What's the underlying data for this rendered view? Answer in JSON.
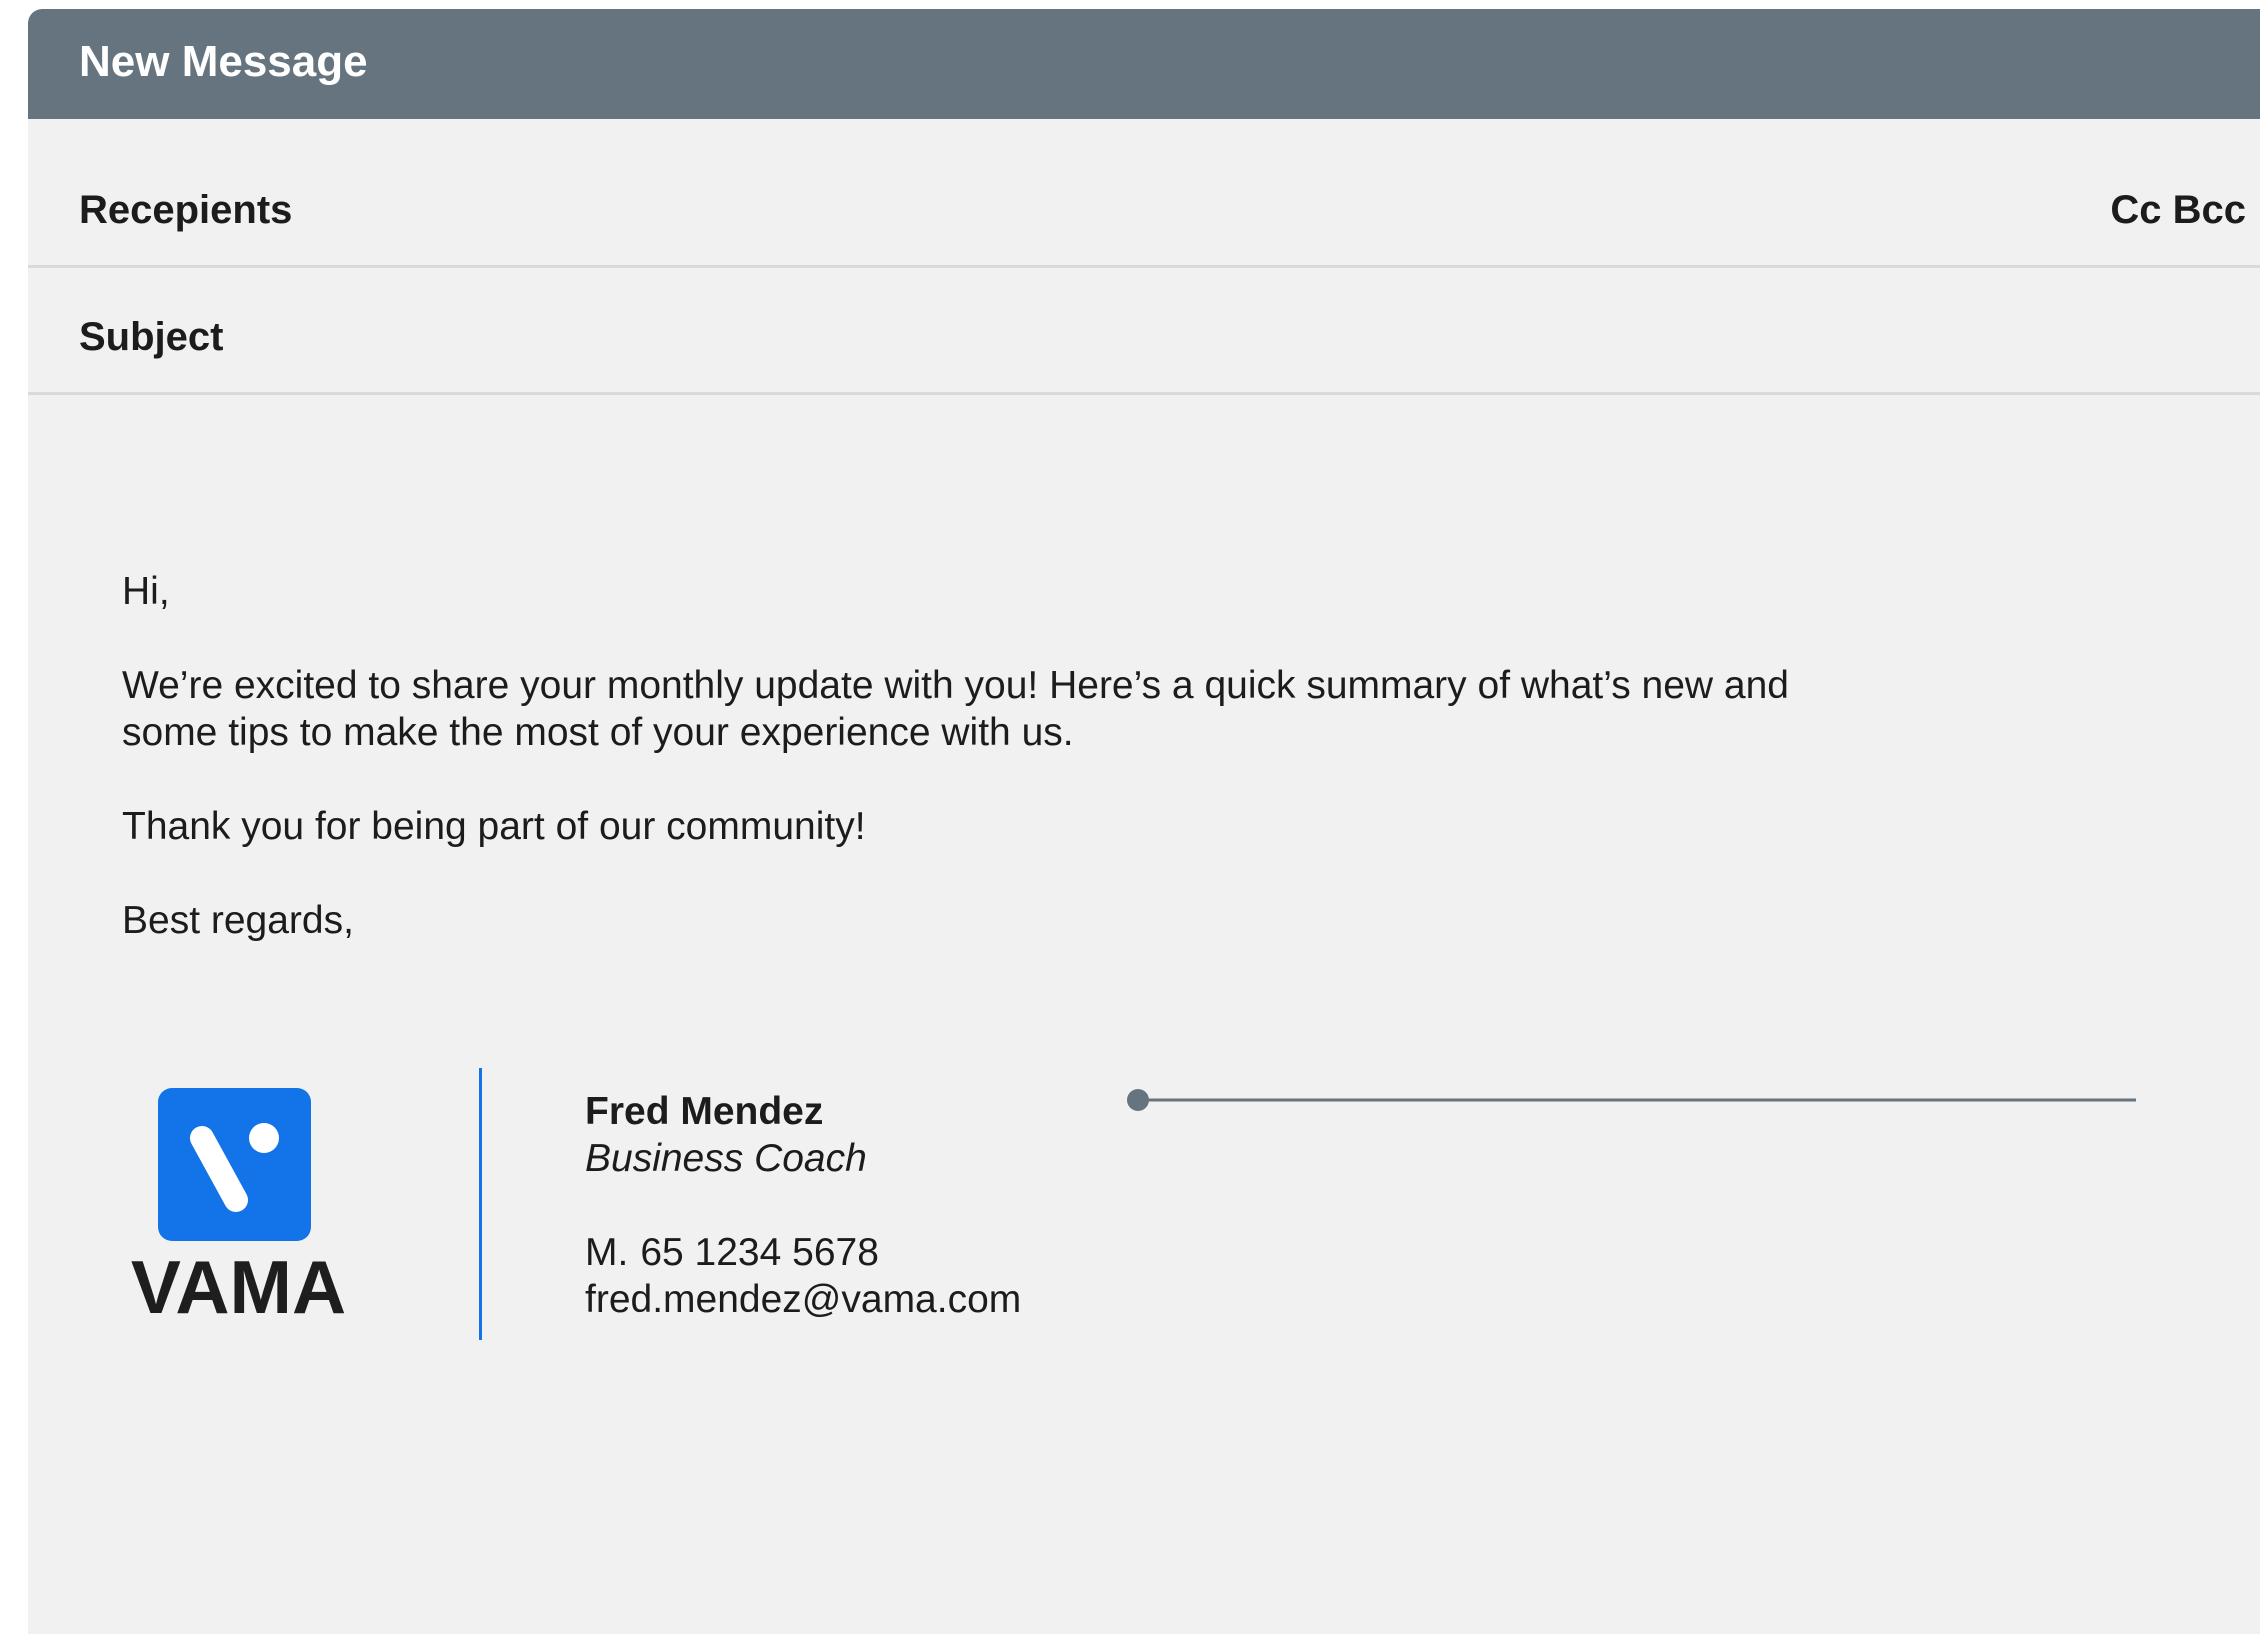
{
  "window": {
    "title": "New Message"
  },
  "fields": {
    "recipients_label": "Recepients",
    "cc_label": "Cc",
    "bcc_label": "Bcc",
    "subject_label": "Subject"
  },
  "message": {
    "greeting": "Hi,",
    "paragraph1": "We’re excited to share your monthly update with you! Here’s a quick summary of what’s new and\nsome tips to make the most of your experience with us.",
    "paragraph2": "Thank you for being part of our community!",
    "closing": "Best regards,"
  },
  "signature": {
    "logo_text": "VAMA",
    "name": "Fred Mendez",
    "role": "Business Coach",
    "phone_prefix": "M.",
    "phone": "65 1234 5678",
    "email": "fred.mendez@vama.com"
  },
  "colors": {
    "titlebar": "#66747f",
    "background": "#f1f1f1",
    "brand": "#1274e8",
    "text": "#1c1c1c"
  },
  "icons": {
    "logo_mark": "vama-logo-icon"
  }
}
